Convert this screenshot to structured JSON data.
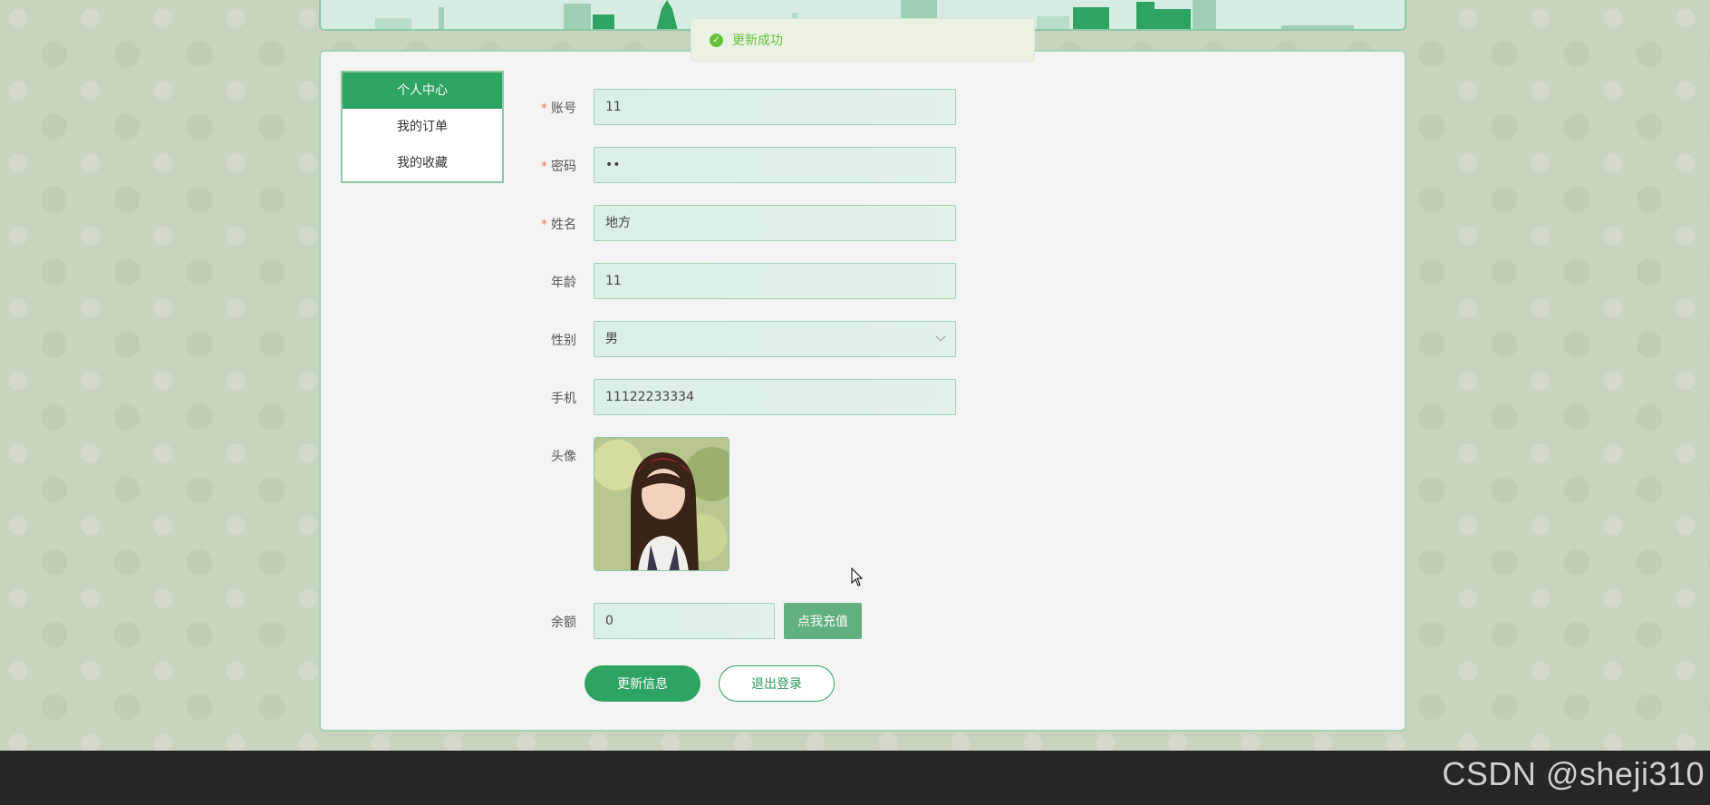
{
  "toast": {
    "message": "更新成功",
    "icon": "check-circle-icon",
    "color": "#67c23a"
  },
  "sidebar": {
    "items": [
      {
        "label": "个人中心",
        "active": true
      },
      {
        "label": "我的订单",
        "active": false
      },
      {
        "label": "我的收藏",
        "active": false
      }
    ]
  },
  "form": {
    "account": {
      "label": "账号",
      "required": "*",
      "value": "11"
    },
    "password": {
      "label": "密码",
      "required": "*",
      "value": "••"
    },
    "name": {
      "label": "姓名",
      "required": "*",
      "value": "地方"
    },
    "age": {
      "label": "年龄",
      "value": "11"
    },
    "gender": {
      "label": "性别",
      "value": "男"
    },
    "phone": {
      "label": "手机",
      "value": "11122233334"
    },
    "avatar": {
      "label": "头像"
    },
    "balance": {
      "label": "余额",
      "value": "0",
      "recharge_label": "点我充值"
    }
  },
  "actions": {
    "update_label": "更新信息",
    "logout_label": "退出登录"
  },
  "watermark": "CSDN @sheji310",
  "colors": {
    "primary": "#2ea362",
    "accent_light": "#62b07f",
    "required": "#f56c6c"
  }
}
